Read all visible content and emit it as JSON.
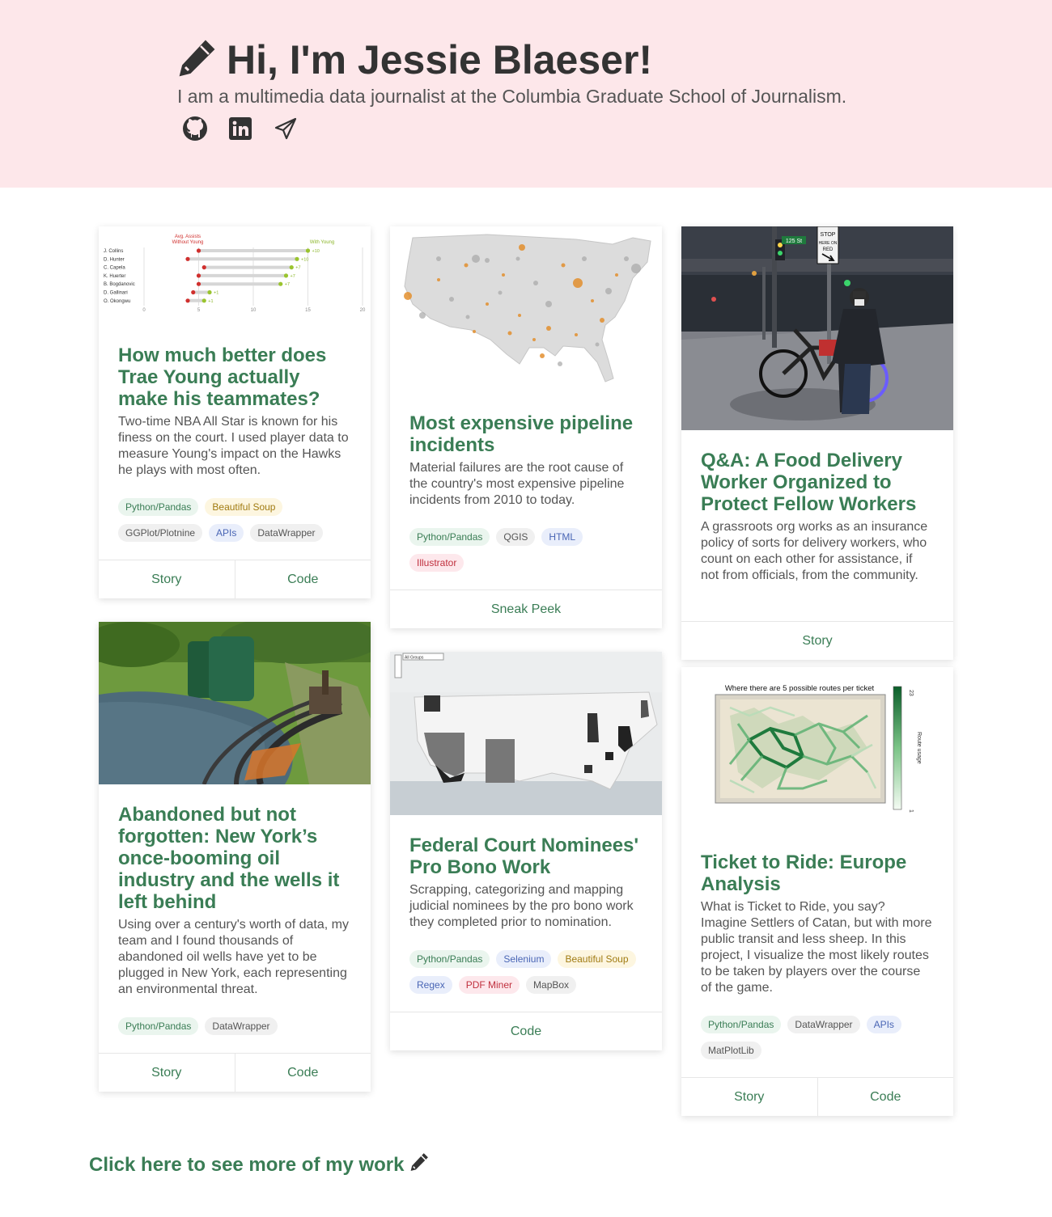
{
  "hero": {
    "title": "Hi, I'm Jessie Blaeser!",
    "subtitle": "I am a multimedia data journalist at the Columbia Graduate School of Journalism.",
    "icons": [
      "pencil-icon",
      "github-icon",
      "linkedin-icon",
      "paper-plane-icon"
    ]
  },
  "cards": [
    {
      "title": "How much better does Trae Young actually make his teammates?",
      "description": "Two-time NBA All Star is known for his finess on the court. I used player data to measure Young's impact on the Hawks he plays with most often.",
      "tags": [
        "Python/Pandas",
        "Beautiful Soup",
        "GGPlot/Plotnine",
        "APIs",
        "DataWrapper"
      ],
      "actions": [
        "Story",
        "Code"
      ],
      "thumb": {
        "legend_without": "Avg. Assists\nWithout Young",
        "legend_with": "With Young",
        "players": [
          "J. Collins",
          "D. Hunter",
          "C. Capela",
          "K. Huerter",
          "B. Bogdanovic",
          "D. Gallinari",
          "O. Okongwu"
        ],
        "diffs": [
          "+10",
          "+10",
          "+7",
          "+7",
          "+7",
          "+1",
          "+1"
        ],
        "axis": [
          "0",
          "5",
          "10",
          "15",
          "20"
        ]
      }
    },
    {
      "title": "Most expensive pipeline incidents",
      "description": "Material failures are the root cause of the country's most expensive pipeline incidents from 2010 to today.",
      "tags": [
        "Python/Pandas",
        "QGIS",
        "HTML",
        "Illustrator"
      ],
      "actions": [
        "Sneak Peek"
      ]
    },
    {
      "title": "Q&A: A Food Delivery Worker Organized to Protect Fellow Workers",
      "description": "A grassroots org works as an insurance policy of sorts for delivery workers, who count on each other for assistance, if not from officials, from the community.",
      "tags": [],
      "actions": [
        "Story"
      ],
      "thumb": {
        "street_sign": "125 St",
        "stop_sign": "STOP HERE ON RED"
      }
    },
    {
      "title": "Abandoned but not forgotten: New York’s once-booming oil industry and the wells it left behind",
      "description": "Using over a century's worth of data, my team and I found thousands of abandoned oil wells have yet to be plugged in New York, each representing an environmental threat.",
      "tags": [
        "Python/Pandas",
        "DataWrapper"
      ],
      "actions": [
        "Story",
        "Code"
      ]
    },
    {
      "title": "Federal Court Nominees' Pro Bono Work",
      "description": "Scrapping, categorizing and mapping judicial nominees by the pro bono work they completed prior to nomination.",
      "tags": [
        "Python/Pandas",
        "Selenium",
        "Beautiful Soup",
        "Regex",
        "PDF Miner",
        "MapBox"
      ],
      "actions": [
        "Code"
      ],
      "thumb": {
        "dropdown": "All Groups"
      }
    },
    {
      "title": "Ticket to Ride: Europe Analysis",
      "description": "What is Ticket to Ride, you say? Imagine Settlers of Catan, but with more public transit and less sheep. In this project, I visualize the most likely routes to be taken by players over the course of the game.",
      "tags": [
        "Python/Pandas",
        "DataWrapper",
        "APIs",
        "MatPlotLib"
      ],
      "actions": [
        "Story",
        "Code"
      ],
      "thumb": {
        "title": "Where there are 5 possible routes per ticket",
        "colorbar_label": "Route usage",
        "colorbar_max": "23",
        "colorbar_min": "1"
      }
    }
  ],
  "tag_colors": {
    "Python/Pandas": "green",
    "Beautiful Soup": "yellow",
    "GGPlot/Plotnine": "gray",
    "APIs": "blue",
    "DataWrapper": "gray",
    "QGIS": "gray",
    "HTML": "blue",
    "Illustrator": "red",
    "Selenium": "blue",
    "Regex": "blue",
    "PDF Miner": "red",
    "MapBox": "gray",
    "MatPlotLib": "gray"
  },
  "footer": {
    "more_link": "Click here to see more of my work"
  },
  "colors": {
    "hero_bg": "#fde7ea",
    "accent": "#3a7d55",
    "text": "#444444"
  }
}
